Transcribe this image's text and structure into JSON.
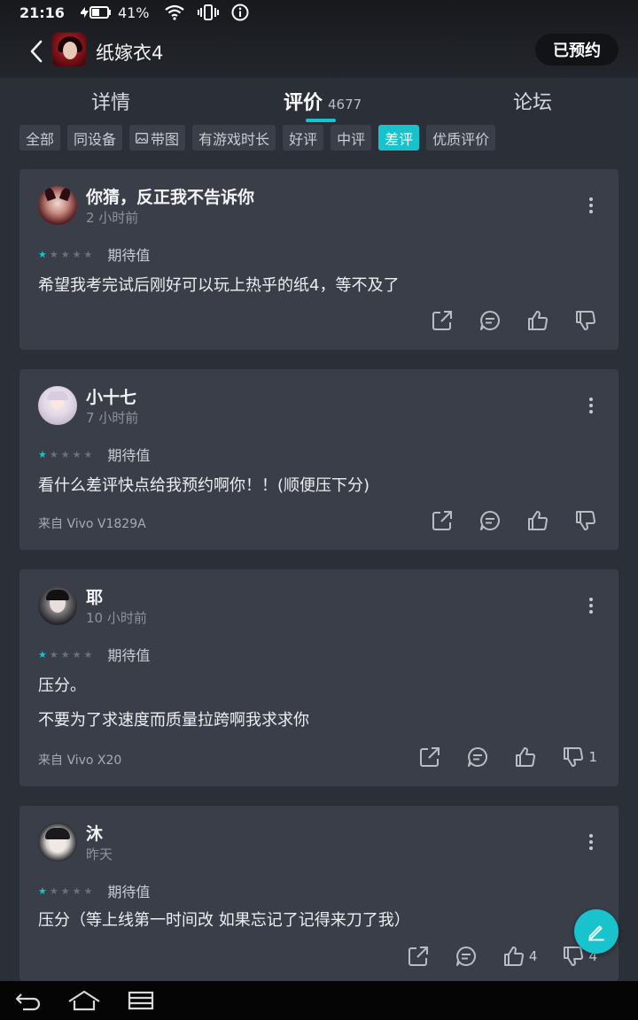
{
  "status": {
    "time": "21:16",
    "battery": "41%"
  },
  "header": {
    "game_title": "纸嫁衣4",
    "reserve_label": "已预约"
  },
  "tabs": [
    {
      "label": "详情"
    },
    {
      "label": "评价",
      "count": "4677"
    },
    {
      "label": "论坛"
    }
  ],
  "filters": [
    "全部",
    "同设备",
    "带图",
    "有游戏时长",
    "好评",
    "中评",
    "差评",
    "优质评价"
  ],
  "active_filter": "差评",
  "reviews": [
    {
      "name": "你猜，反正我不告诉你",
      "time": "2 小时前",
      "stars": 1,
      "rating_label": "期待值",
      "lines": [
        "希望我考完试后刚好可以玩上热乎的纸4，等不及了"
      ],
      "device": "",
      "likes": "",
      "dislikes": ""
    },
    {
      "name": "小十七",
      "time": "7 小时前",
      "stars": 1,
      "rating_label": "期待值",
      "lines": [
        "看什么差评快点给我预约啊你！！(顺便压下分)"
      ],
      "device": "来自 Vivo V1829A",
      "likes": "",
      "dislikes": ""
    },
    {
      "name": "耶",
      "time": "10 小时前",
      "stars": 1,
      "rating_label": "期待值",
      "lines": [
        "压分。",
        "不要为了求速度而质量拉跨啊我求求你"
      ],
      "device": "来自 Vivo X20",
      "likes": "",
      "dislikes": "1"
    },
    {
      "name": "沐",
      "time": "昨天",
      "stars": 1,
      "rating_label": "期待值",
      "lines": [
        "压分（等上线第一时间改 如果忘记了记得来刀了我）"
      ],
      "device": "",
      "likes": "4",
      "dislikes": "4"
    }
  ],
  "colors": {
    "accent": "#19c3cd",
    "card": "#3a3e48",
    "background": "#2b2f38"
  }
}
